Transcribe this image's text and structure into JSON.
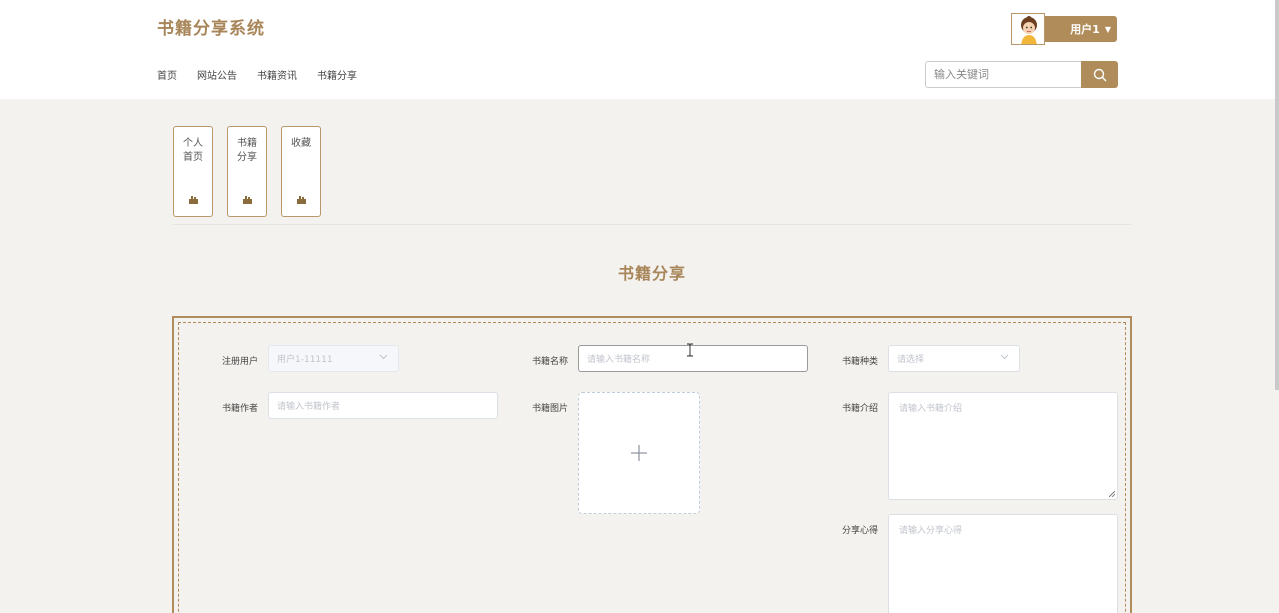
{
  "header": {
    "site_title": "书籍分享系统",
    "nav": [
      "首页",
      "网站公告",
      "书籍资讯",
      "书籍分享"
    ],
    "user_label": "用户1",
    "search_placeholder": "输入关键词"
  },
  "side_tiles": [
    {
      "label": "个人首页"
    },
    {
      "label": "书籍分享"
    },
    {
      "label": "收藏"
    }
  ],
  "page_heading": "书籍分享",
  "form": {
    "user": {
      "label": "注册用户",
      "value": "用户1-11111"
    },
    "book_name": {
      "label": "书籍名称",
      "placeholder": "请输入书籍名称"
    },
    "book_type": {
      "label": "书籍种类",
      "placeholder": "请选择"
    },
    "author": {
      "label": "书籍作者",
      "placeholder": "请输入书籍作者"
    },
    "image": {
      "label": "书籍图片"
    },
    "intro": {
      "label": "书籍介绍",
      "placeholder": "请输入书籍介绍"
    },
    "notes": {
      "label": "分享心得",
      "placeholder": "请输入分享心得"
    }
  },
  "colors": {
    "accent": "#b08c5b",
    "title": "#a8865a",
    "background": "#f3f2ef"
  }
}
